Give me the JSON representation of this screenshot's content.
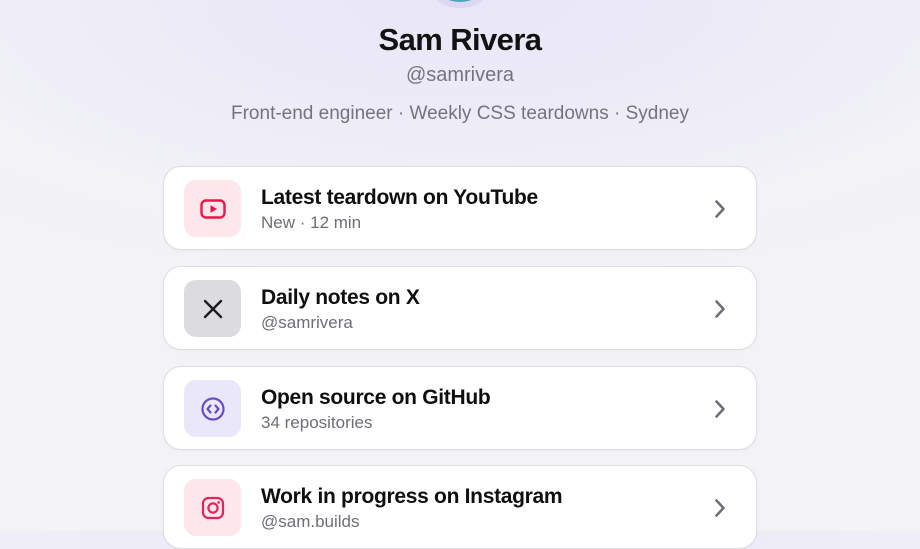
{
  "profile": {
    "name": "Sam Rivera",
    "handle": "@samrivera",
    "bio": "Front-end engineer · Weekly CSS teardowns · Sydney"
  },
  "links": [
    {
      "title": "Latest teardown on YouTube",
      "subtitle": "New · 12 min",
      "icon": "youtube-icon",
      "icon_color": "#e8174a",
      "tile_color": "#fde7ea"
    },
    {
      "title": "Daily notes on X",
      "subtitle": "@samrivera",
      "icon": "x-icon",
      "icon_color": "#1c1c1e",
      "tile_color": "#dcdce0"
    },
    {
      "title": "Open source on GitHub",
      "subtitle": "34 repositories",
      "icon": "code-icon",
      "icon_color": "#6a4cc2",
      "tile_color": "#ebe7fb"
    },
    {
      "title": "Work in progress on Instagram",
      "subtitle": "@sam.builds",
      "icon": "instagram-icon",
      "icon_color": "#e0245e",
      "tile_color": "#fde7ea"
    }
  ],
  "colors": {
    "chevron": "#6e6e76"
  }
}
